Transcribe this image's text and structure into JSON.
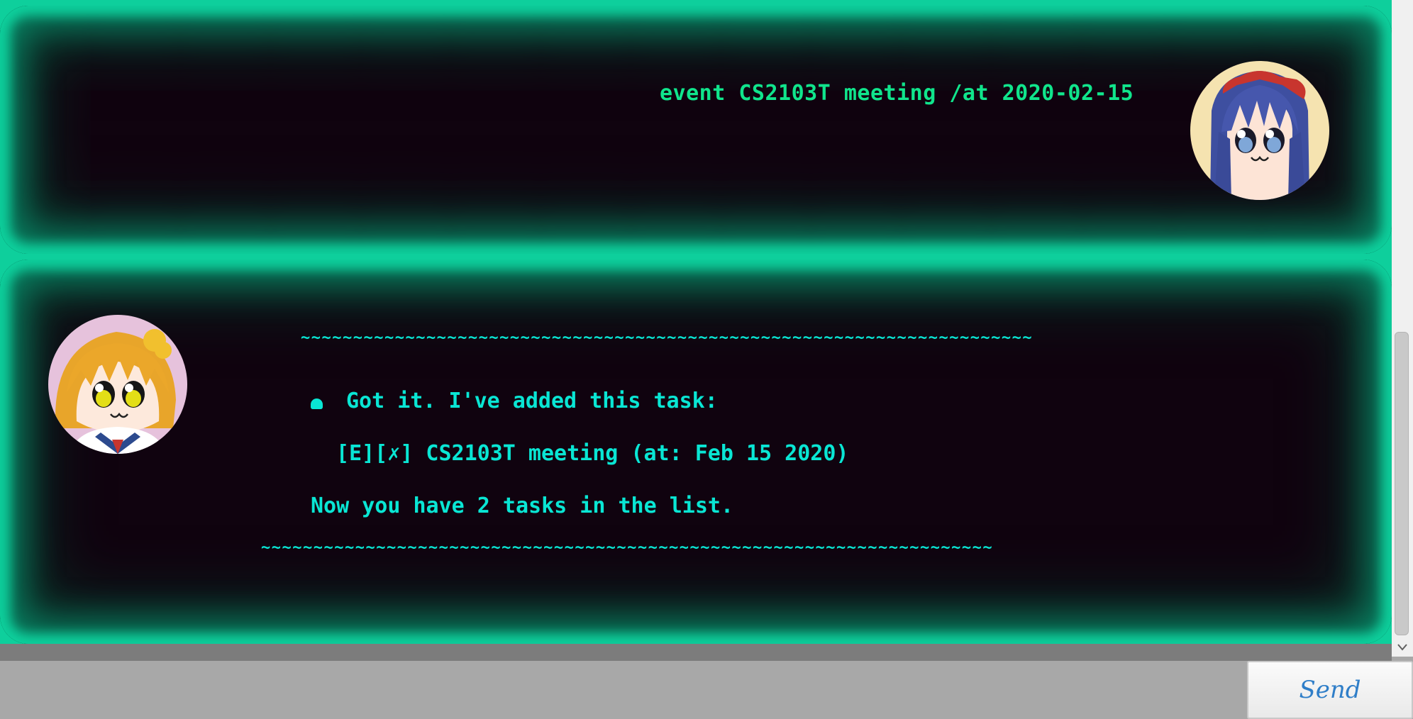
{
  "conversation": {
    "user_message": {
      "text": "event CS2103T meeting /at 2020-02-15",
      "avatar_icon": "user-avatar-blue-hair-girl"
    },
    "bot_message": {
      "divider_top": "~~~~~~~~~~~~~~~~~~~~~~~~~~~~~~~~~~~~~~~~~~~~~~~~~~~~~~~~~~~~~~~~~~~~~~",
      "bullet_icon": "bullet-icon",
      "line1": "Got it. I've added this task:",
      "line2": "[E][✗] CS2103T meeting (at: Feb 15 2020)",
      "line3": "Now you have 2 tasks in the list.",
      "divider_bottom": "~~~~~~~~~~~~~~~~~~~~~~~~~~~~~~~~~~~~~~~~~~~~~~~~~~~~~~~~~~~~~~~~~~~~~~",
      "avatar_icon": "bot-avatar-orange-hair-girl"
    }
  },
  "input": {
    "value": "",
    "placeholder": ""
  },
  "send_button": {
    "label": "Send"
  },
  "colors": {
    "glow": "#0ecf9c",
    "panel_background": "#10030f",
    "user_text": "#10e58c",
    "bot_text": "#09e6d4",
    "input_background": "#a8a8a8",
    "send_label": "#2f7ec8"
  }
}
